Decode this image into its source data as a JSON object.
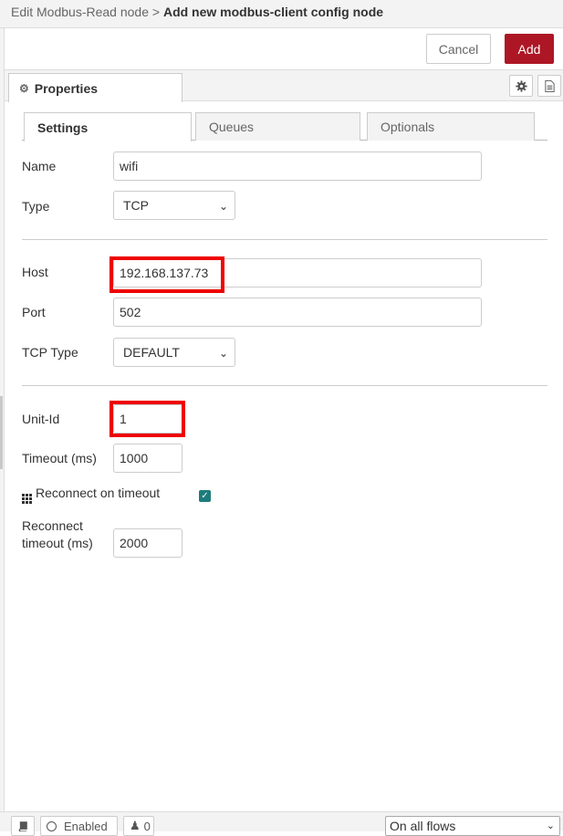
{
  "header": {
    "breadcrumb_prefix": "Edit Modbus-Read node >",
    "title": "Add new modbus-client config node",
    "cancel_label": "Cancel",
    "add_label": "Add",
    "accent_color": "#ad1625"
  },
  "properties_tab": {
    "label": "Properties",
    "icon": "gear-icon"
  },
  "tool_icons": [
    "gear-icon",
    "document-icon"
  ],
  "subtabs": [
    {
      "label": "Settings",
      "active": true
    },
    {
      "label": "Queues",
      "active": false
    },
    {
      "label": "Optionals",
      "active": false
    }
  ],
  "form": {
    "name_label": "Name",
    "name_value": "wifi",
    "type_label": "Type",
    "type_value": "TCP",
    "host_label": "Host",
    "host_value": "192.168.137.73",
    "port_label": "Port",
    "port_value": "502",
    "tcp_type_label": "TCP Type",
    "tcp_type_value": "DEFAULT",
    "unit_id_label": "Unit-Id",
    "unit_id_value": "1",
    "timeout_label": "Timeout (ms)",
    "timeout_value": "1000",
    "reconnect_on_timeout_label": "Reconnect on timeout",
    "reconnect_on_timeout_checked": true,
    "reconnect_timeout_label_line1": "Reconnect",
    "reconnect_timeout_label_line2": "timeout (ms)",
    "reconnect_timeout_value": "2000"
  },
  "highlight_color": "#ee0000",
  "footer": {
    "enabled_label": "Enabled",
    "users_count": "0",
    "scope_value": "On all flows"
  }
}
